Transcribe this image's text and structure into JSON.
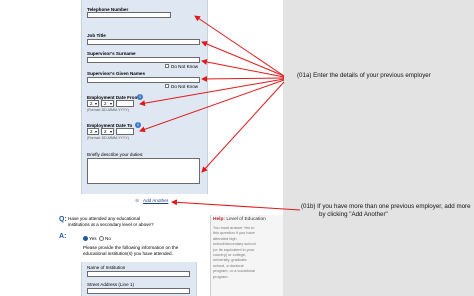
{
  "form": {
    "telephone_label": "Telephone Number",
    "job_title_label": "Job Title",
    "supervisor_surname_label": "Supervisor's Surname",
    "supervisor_given_label": "Supervisor's Given Names",
    "do_not_know": "Do Not Know",
    "date_from_label": "Employment Date From",
    "date_to_label": "Employment Date To",
    "date_format": "(Format: DD-MMM-YYYY)",
    "date_day": "2",
    "date_month": "2",
    "describe_label": "Briefly describe your duties:",
    "add_another": "Add Another",
    "question_letter": "Q:",
    "question_text": "Have you attended any educational institutions at a secondary level or above?",
    "answer_letter": "A:",
    "yes_label": "Yes",
    "no_label": "No",
    "provide_text": "Please provide the following information on the educational institution(s) you have attended.",
    "institution_label": "Name of Institution",
    "street_label": "Street Address (Line 1)"
  },
  "help": {
    "prefix": "Help:",
    "title": "Level of Education",
    "text": "You must answer Yes to this question if you have attended high school/secondary school (or its equivalent in your country) or college, university, graduate school, a doctoral program, or a vocational program."
  },
  "annotations": {
    "a": "(01a)  Enter the details of your previous employer",
    "b_line1": "(01b)    If you have more than one previous employer, add more",
    "b_line2": "by clicking \"Add Another\""
  },
  "colors": {
    "arrow": "#e0191b",
    "link": "#1a3e8c",
    "panel": "#dfe8f2",
    "accent": "#2157a6"
  }
}
